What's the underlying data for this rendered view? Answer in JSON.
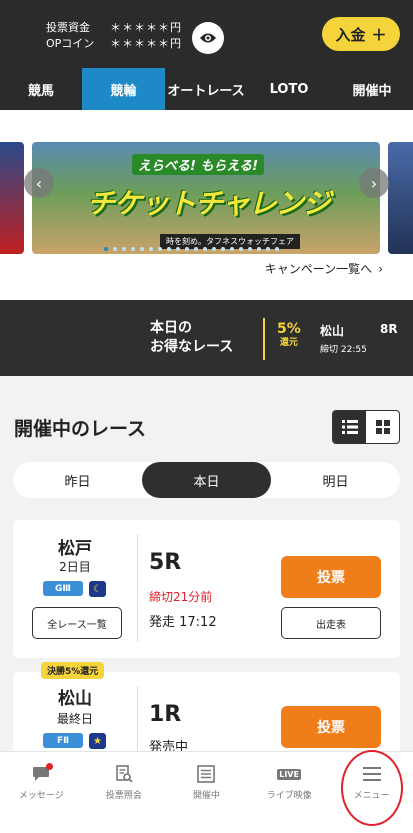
{
  "header": {
    "balance_label": "投票資金",
    "balance_value": "＊＊＊＊＊円",
    "op_label": "OPコイン",
    "op_value": "＊＊＊＊＊円",
    "eye_icon": "eye-icon",
    "deposit_label": "入金"
  },
  "tabs": [
    {
      "label": "競馬"
    },
    {
      "label": "競輪"
    },
    {
      "label": "オートレース"
    },
    {
      "label": "LOTO"
    },
    {
      "label": "開催中"
    }
  ],
  "active_tab": "競輪",
  "banner": {
    "sub": "えらべる! もらえる!",
    "title": "チケットチャレンジ",
    "foot": "時を刻め。タフネスウォッチフェア",
    "campaign_link": "キャンペーン一覧へ"
  },
  "deal": {
    "title_line1": "本日の",
    "title_line2": "お得なレース",
    "pct": "5%",
    "pct_sub": "還元",
    "venue": "松山",
    "race": "8R",
    "deadline": "締切 22:55"
  },
  "section": {
    "title": "開催中のレース"
  },
  "day_tabs": [
    {
      "label": "昨日"
    },
    {
      "label": "本日"
    },
    {
      "label": "明日"
    }
  ],
  "races": [
    {
      "venue": "松戸",
      "day": "2日目",
      "grade": "GⅢ",
      "badge": "☾",
      "all_races": "全レース一覧",
      "race_no": "5R",
      "deadline": "締切21分前",
      "start": "発走 17:12",
      "bet_label": "投票",
      "entry_label": "出走表"
    },
    {
      "promo": "決勝5%還元",
      "venue": "松山",
      "day": "最終日",
      "grade": "FⅡ",
      "badge": "★",
      "race_no": "1R",
      "start": "発売中",
      "bet_label": "投票"
    }
  ],
  "bottom_nav": [
    {
      "label": "メッセージ",
      "icon": "message-icon"
    },
    {
      "label": "投票照会",
      "icon": "receipt-search-icon"
    },
    {
      "label": "開催中",
      "icon": "list-icon"
    },
    {
      "label": "ライブ映像",
      "icon": "live-icon",
      "badge": "LIVE"
    },
    {
      "label": "メニュー",
      "icon": "menu-icon"
    }
  ],
  "colors": {
    "header_bg": "#2b2b2b",
    "accent_blue": "#1d89c6",
    "accent_yellow": "#f5d33b",
    "bet_orange": "#ef7d1a",
    "alert_red": "#e0202a"
  }
}
